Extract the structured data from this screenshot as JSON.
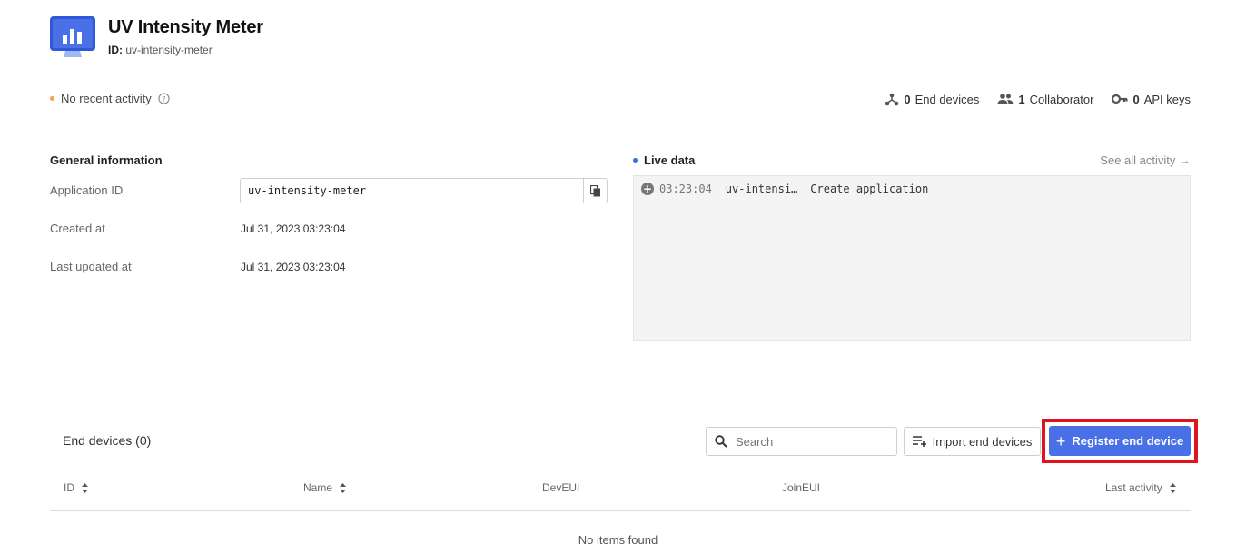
{
  "header": {
    "title": "UV Intensity Meter",
    "id_label": "ID:",
    "id_value": "uv-intensity-meter",
    "activity": "No recent activity",
    "status_color": "#f3a24b"
  },
  "stats": {
    "end_devices_count": "0",
    "end_devices_label": "End devices",
    "collaborators_count": "1",
    "collaborators_label": "Collaborator",
    "api_keys_count": "0",
    "api_keys_label": "API keys"
  },
  "general": {
    "title": "General information",
    "app_id_label": "Application ID",
    "app_id_value": "uv-intensity-meter",
    "created_label": "Created at",
    "created_value": "Jul 31, 2023 03:23:04",
    "updated_label": "Last updated at",
    "updated_value": "Jul 31, 2023 03:23:04"
  },
  "live": {
    "title": "Live data",
    "see_all": "See all activity →",
    "events": [
      {
        "time": "03:23:04",
        "device": "uv-intensi…",
        "event": "Create application"
      }
    ]
  },
  "end_devices": {
    "title": "End devices (0)",
    "search_placeholder": "Search",
    "import_label": "Import end devices",
    "register_label": "Register end device",
    "accent_color": "#4a70e8",
    "highlight_color": "#e1141d",
    "columns": [
      "ID",
      "Name",
      "DevEUI",
      "JoinEUI",
      "Last activity"
    ],
    "empty_text": "No items found"
  }
}
